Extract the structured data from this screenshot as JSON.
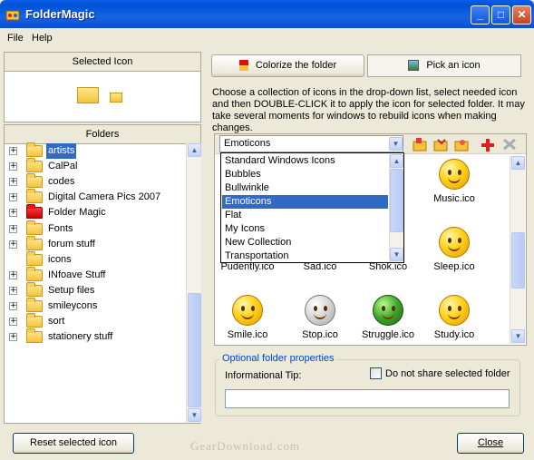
{
  "window": {
    "title": "FolderMagic",
    "minimize": "_",
    "maximize": "□",
    "close": "✕"
  },
  "menu": {
    "items": [
      "File",
      "Help"
    ]
  },
  "left": {
    "selected_icon_header": "Selected Icon",
    "folders_header": "Folders",
    "tree": [
      {
        "label": "artists",
        "expandable": true,
        "selected": true,
        "red": false
      },
      {
        "label": "CalPal",
        "expandable": true,
        "selected": false,
        "red": false
      },
      {
        "label": "codes",
        "expandable": true,
        "selected": false,
        "red": false
      },
      {
        "label": "Digital Camera Pics 2007",
        "expandable": true,
        "selected": false,
        "red": false
      },
      {
        "label": "Folder Magic",
        "expandable": true,
        "selected": false,
        "red": true
      },
      {
        "label": "Fonts",
        "expandable": true,
        "selected": false,
        "red": false
      },
      {
        "label": "forum stuff",
        "expandable": true,
        "selected": false,
        "red": false
      },
      {
        "label": "icons",
        "expandable": false,
        "selected": false,
        "red": false
      },
      {
        "label": "INfoave Stuff",
        "expandable": true,
        "selected": false,
        "red": false
      },
      {
        "label": "Setup files",
        "expandable": true,
        "selected": false,
        "red": false
      },
      {
        "label": "smileycons",
        "expandable": true,
        "selected": false,
        "red": false
      },
      {
        "label": "sort",
        "expandable": true,
        "selected": false,
        "red": false
      },
      {
        "label": "stationery stuff",
        "expandable": true,
        "selected": false,
        "red": false
      }
    ],
    "reset_button": "Reset selected icon"
  },
  "tabs": {
    "colorize": "Colorize the folder",
    "pick": "Pick an icon"
  },
  "instructions": "Choose a collection of icons in the drop-down list, select needed icon and then DOUBLE-CLICK it to apply the icon for selected folder. It may take several moments for windows to rebuild icons when making changes.",
  "collection": {
    "selected": "Emoticons",
    "options": [
      "Standard Windows Icons",
      "Bubbles",
      "Bullwinkle",
      "Emoticons",
      "Flat",
      "My Icons",
      "New Collection",
      "Transportation"
    ]
  },
  "icons": {
    "row1": [
      "Music.ico"
    ],
    "row2": [
      "Pudently.ico",
      "Sad.ico",
      "Shok.ico",
      "Sleep.ico"
    ],
    "row3": [
      "Smile.ico",
      "Stop.ico",
      "Struggle.ico",
      "Study.ico"
    ]
  },
  "options": {
    "title": "Optional folder properties",
    "tip_label": "Informational Tip:",
    "tip_value": "",
    "no_share_label": "Do not share selected folder",
    "no_share_checked": false
  },
  "close_button": "Close",
  "watermark": "GearDownload.com"
}
